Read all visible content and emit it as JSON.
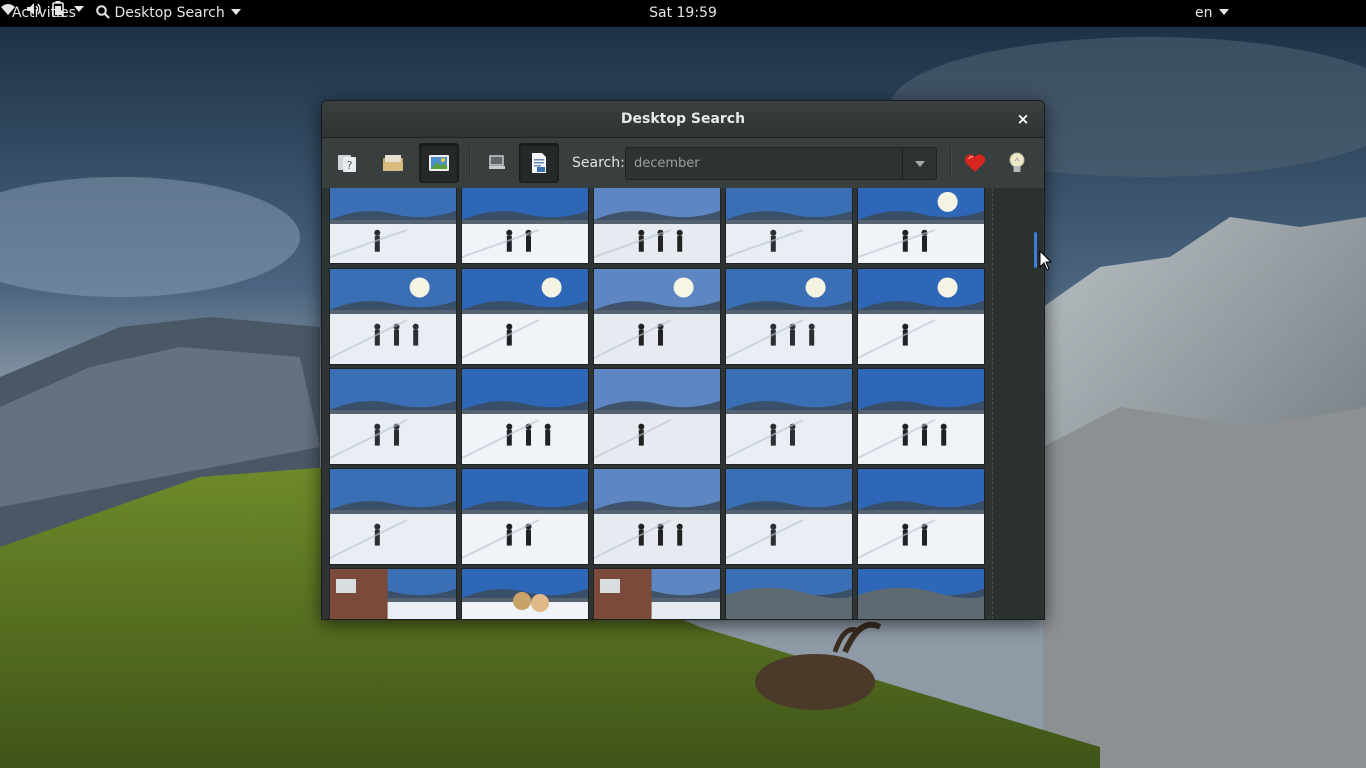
{
  "topbar": {
    "activities": "Activities",
    "app_menu": "Desktop Search",
    "clock": "Sat 19:59",
    "language": "en"
  },
  "window": {
    "title": "Desktop Search",
    "close_glyph": "×",
    "toolbar": {
      "buttons": [
        {
          "name": "help-icon"
        },
        {
          "name": "folder-icon"
        },
        {
          "name": "images-icon",
          "active": true
        },
        {
          "name": "computer-icon"
        },
        {
          "name": "document-icon",
          "active": true
        }
      ],
      "search_label": "Search:",
      "search_value": "december",
      "favorites_icon": "heart-icon",
      "tips_icon": "lightbulb-icon"
    }
  },
  "colors": {
    "accent": "#3d7dd6",
    "window_bg": "#393f3f",
    "results_bg": "#2e3333"
  },
  "results": {
    "rows": 5,
    "columns": 5,
    "thumbnails": [
      "snow-path-trees",
      "people-upside-down",
      "snow-person",
      "snow-people",
      "snow-people-lake",
      "snow-trees-sun",
      "snow-person-sun",
      "snow-field-trees",
      "snow-couple-sun",
      "snow-sun-cliff",
      "snow-person-field",
      "snow-people-field",
      "snow-road-trees",
      "snow-person-bent",
      "snow-person-crouch",
      "snow-slope",
      "snow-slope-people",
      "snow-field-people",
      "snow-field-person",
      "snow-field-person",
      "chalet-people",
      "skier-selfie",
      "chalet-snow",
      "mountain-sky",
      "mountain-sky"
    ]
  }
}
